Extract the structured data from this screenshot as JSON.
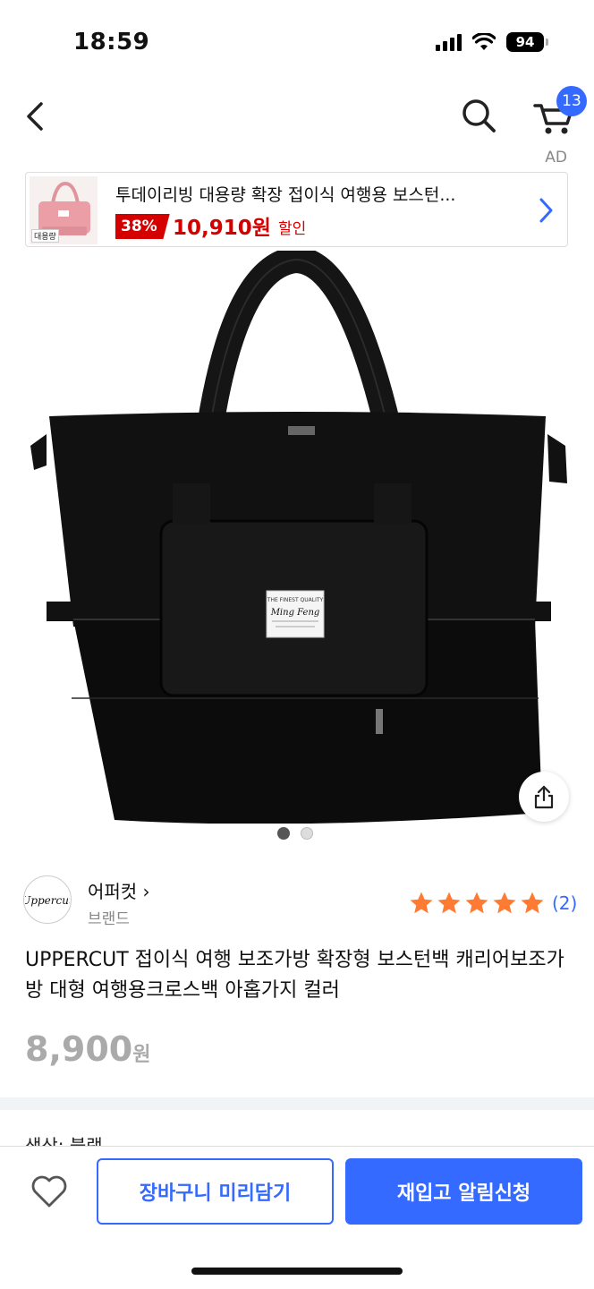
{
  "status_bar": {
    "time": "18:59",
    "battery": "94"
  },
  "nav": {
    "cart_count": "13"
  },
  "ad": {
    "label": "AD",
    "title": "투데이리빙 대용량 확장 접이식 여행용 보스턴...",
    "discount": "38%",
    "price": "10,910원",
    "sale_word": "할인",
    "thumb_tag": "대용량"
  },
  "product_image": {
    "patch_line1": "THE FINEST QUALITY",
    "patch_brand": "Ming Feng"
  },
  "gallery": {
    "current": 1,
    "total": 2
  },
  "brand": {
    "logo_text": "Uppercut",
    "name": "어퍼컷 ›",
    "sub": "브랜드"
  },
  "rating": {
    "stars": 5,
    "count": "(2)"
  },
  "product": {
    "title": "UPPERCUT 접이식 여행 보조가방 확장형 보스턴백 캐리어보조가방 대형 여행용크로스백 아홉가지 컬러",
    "price_number": "8,900",
    "price_unit": "원"
  },
  "cut_text": "색상: 블랙",
  "bottom": {
    "cart_add_label": "장바구니 미리담기",
    "restock_label": "재입고 알림신청"
  },
  "colors": {
    "accent": "#346aff",
    "sale_red": "#d40000",
    "star": "#ff7a33"
  }
}
